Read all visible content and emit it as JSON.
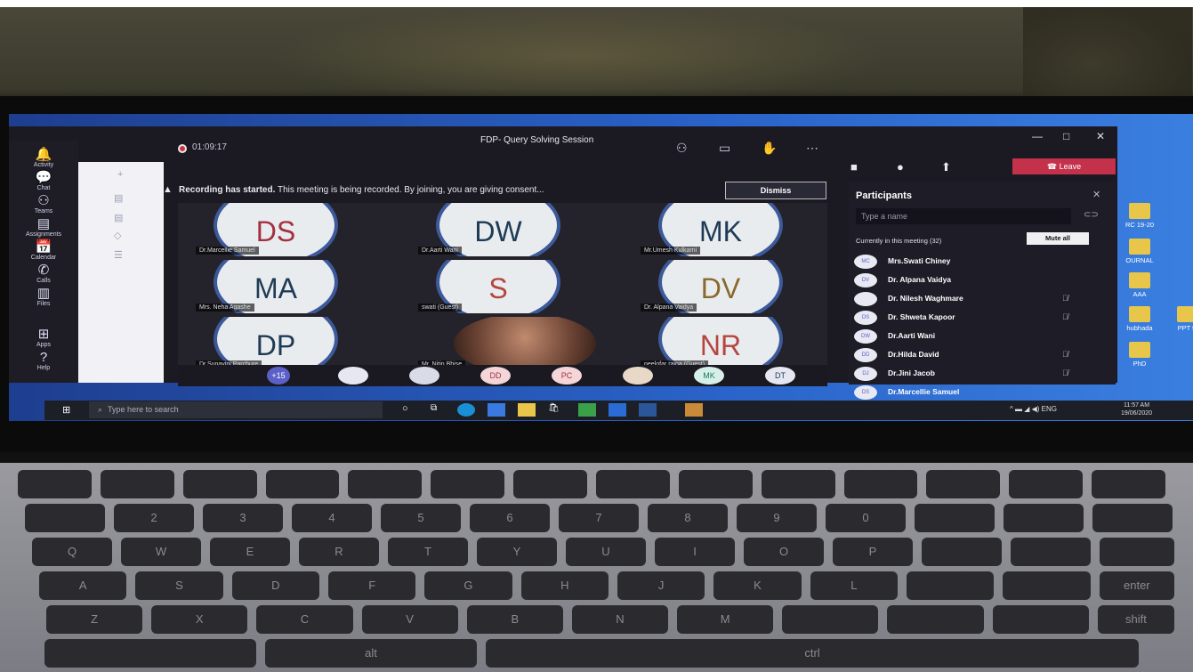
{
  "window": {
    "title": "FDP- Query Solving Session",
    "timer": "01:09:17"
  },
  "rail": [
    {
      "label": "Activity",
      "icon": "bell-icon"
    },
    {
      "label": "Chat",
      "icon": "chat-icon"
    },
    {
      "label": "Teams",
      "icon": "teams-icon"
    },
    {
      "label": "Assignments",
      "icon": "assignments-icon"
    },
    {
      "label": "Calendar",
      "icon": "calendar-icon"
    },
    {
      "label": "Calls",
      "icon": "phone-icon"
    },
    {
      "label": "Files",
      "icon": "files-icon"
    },
    {
      "label": "Apps",
      "icon": "apps-icon"
    },
    {
      "label": "Help",
      "icon": "help-icon"
    }
  ],
  "banner": {
    "bold": "Recording has started.",
    "text": "This meeting is being recorded. By joining, you are giving consent...",
    "dismiss": "Dismiss"
  },
  "controls": {
    "leave": "Leave"
  },
  "tiles": [
    {
      "initials": "DS",
      "name": "Dr.Marcellie Samuel",
      "color": "#a3313f"
    },
    {
      "initials": "DW",
      "name": "Dr.Aarti Wani",
      "color": "#1f3a55"
    },
    {
      "initials": "MK",
      "name": "Mr.Umesh Kulkarni",
      "color": "#1f3a55"
    },
    {
      "initials": "MA",
      "name": "Mrs. Neha Agashe",
      "color": "#1f3a55"
    },
    {
      "initials": "S",
      "name": "swati (Guest)",
      "color": "#b5463f"
    },
    {
      "initials": "DV",
      "name": "Dr. Alpana Vaidya",
      "color": "#8a6a2c"
    },
    {
      "initials": "DP",
      "name": "Dr.Sunayini Parchure",
      "color": "#1f3a55"
    },
    {
      "initials": "",
      "name": "Mr. Nitin Bhise",
      "color": "#000"
    },
    {
      "initials": "NR",
      "name": "neelofar raina (Guest)",
      "color": "#b5463f"
    }
  ],
  "strip": [
    {
      "label": "+15"
    },
    {
      "label": ""
    },
    {
      "label": ""
    },
    {
      "label": "DD"
    },
    {
      "label": "PC"
    },
    {
      "label": ""
    },
    {
      "label": "MK"
    },
    {
      "label": "DT"
    }
  ],
  "participants": {
    "title": "Participants",
    "search_placeholder": "Type a name",
    "section": "Currently in this meeting (32)",
    "mute_all": "Mute all",
    "list": [
      {
        "avatar": "MC",
        "name": "Mrs.Swati Chiney",
        "muted": false
      },
      {
        "avatar": "DV",
        "name": "Dr. Alpana Vaidya",
        "muted": false
      },
      {
        "avatar": "",
        "name": "Dr. Nilesh Waghmare",
        "muted": true
      },
      {
        "avatar": "DS",
        "name": "Dr. Shweta Kapoor",
        "muted": true
      },
      {
        "avatar": "DW",
        "name": "Dr.Aarti Wani",
        "muted": false
      },
      {
        "avatar": "DD",
        "name": "Dr.Hilda David",
        "muted": true
      },
      {
        "avatar": "DJ",
        "name": "Dr.Jini Jacob",
        "muted": true
      },
      {
        "avatar": "DS",
        "name": "Dr.Marcellie Samuel",
        "muted": false
      }
    ]
  },
  "taskbar": {
    "search_placeholder": "Type here to search",
    "lang": "ENG",
    "time": "11:57 AM",
    "date": "19/06/2020"
  },
  "desktop_icons": [
    {
      "label": "RC 19-20"
    },
    {
      "label": "OURNAL"
    },
    {
      "label": "AAA"
    },
    {
      "label": "hubhada"
    },
    {
      "label": "PPT fo"
    },
    {
      "label": "PhD"
    }
  ],
  "keyboard_rows": [
    [
      "",
      "",
      "",
      "",
      "",
      "",
      "",
      "",
      "",
      "",
      "",
      "",
      "",
      ""
    ],
    [
      "",
      "2",
      "3",
      "4",
      "5",
      "6",
      "7",
      "8",
      "9",
      "0",
      "",
      "",
      ""
    ],
    [
      "Q",
      "W",
      "E",
      "R",
      "T",
      "Y",
      "U",
      "I",
      "O",
      "P",
      "",
      "",
      ""
    ],
    [
      "A",
      "S",
      "D",
      "F",
      "G",
      "H",
      "J",
      "K",
      "L",
      "",
      "",
      "enter"
    ],
    [
      "Z",
      "X",
      "C",
      "V",
      "B",
      "N",
      "M",
      "",
      "",
      "",
      "shift"
    ],
    [
      "",
      "alt",
      "",
      "ctrl",
      ""
    ]
  ]
}
